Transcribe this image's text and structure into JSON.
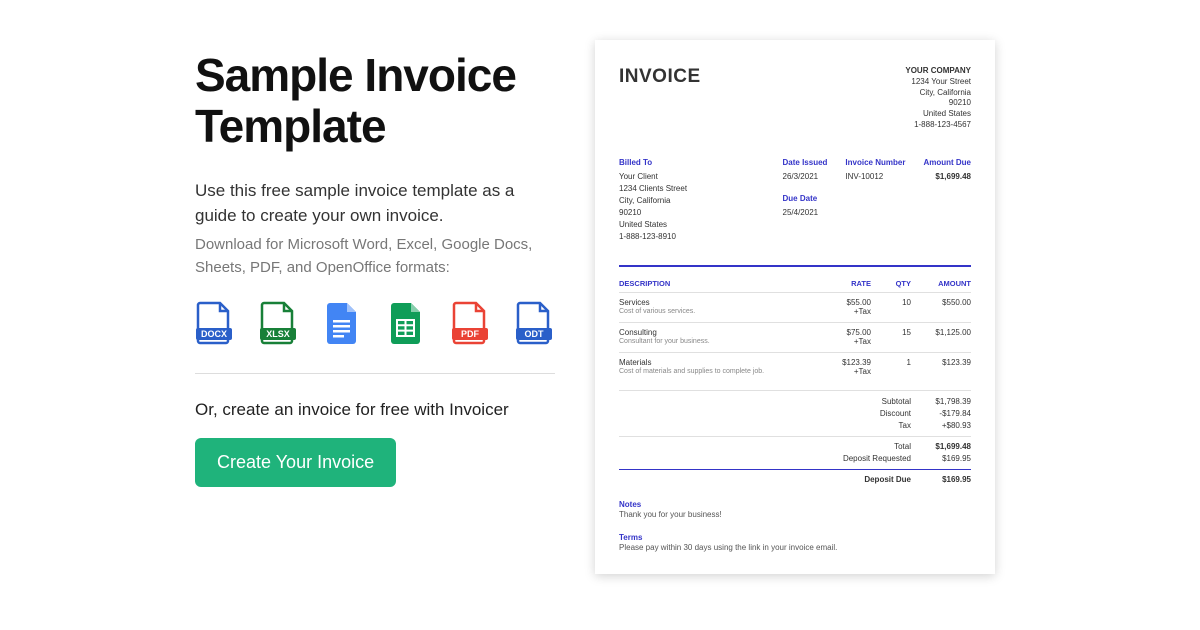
{
  "left": {
    "title": "Sample Invoice Template",
    "subtitle": "Use this free sample invoice template as a guide to create your own invoice.",
    "download_note": "Download for Microsoft Word, Excel, Google Docs, Sheets, PDF, and OpenOffice formats:",
    "or_line": "Or, create an invoice for free with Invoicer",
    "cta": "Create Your Invoice",
    "formats": [
      "DOCX",
      "XLSX",
      "GDOC",
      "GSHEET",
      "PDF",
      "ODT"
    ]
  },
  "invoice": {
    "title": "INVOICE",
    "company": {
      "name": "YOUR COMPANY",
      "street": "1234 Your Street",
      "city": "City, California",
      "zip": "90210",
      "country": "United States",
      "phone": "1-888-123-4567"
    },
    "billed": {
      "label": "Billed To",
      "name": "Your Client",
      "street": "1234 Clients Street",
      "city": "City, California",
      "zip": "90210",
      "country": "United States",
      "phone": "1-888-123-8910"
    },
    "date_issued": {
      "label": "Date Issued",
      "value": "26/3/2021"
    },
    "due_date": {
      "label": "Due Date",
      "value": "25/4/2021"
    },
    "invoice_number": {
      "label": "Invoice Number",
      "value": "INV-10012"
    },
    "amount_due": {
      "label": "Amount Due",
      "value": "$1,699.48"
    },
    "columns": {
      "desc": "DESCRIPTION",
      "rate": "RATE",
      "qty": "QTY",
      "amount": "AMOUNT"
    },
    "items": [
      {
        "name": "Services",
        "desc": "Cost of various services.",
        "rate": "$55.00",
        "tax": "+Tax",
        "qty": "10",
        "amount": "$550.00"
      },
      {
        "name": "Consulting",
        "desc": "Consultant for your business.",
        "rate": "$75.00",
        "tax": "+Tax",
        "qty": "15",
        "amount": "$1,125.00"
      },
      {
        "name": "Materials",
        "desc": "Cost of materials and supplies to complete job.",
        "rate": "$123.39",
        "tax": "+Tax",
        "qty": "1",
        "amount": "$123.39"
      }
    ],
    "summary": {
      "subtotal": {
        "label": "Subtotal",
        "value": "$1,798.39"
      },
      "discount": {
        "label": "Discount",
        "value": "-$179.84"
      },
      "tax": {
        "label": "Tax",
        "value": "+$80.93"
      },
      "total": {
        "label": "Total",
        "value": "$1,699.48"
      },
      "deposit_req": {
        "label": "Deposit Requested",
        "value": "$169.95"
      },
      "deposit_due": {
        "label": "Deposit Due",
        "value": "$169.95"
      }
    },
    "notes": {
      "label": "Notes",
      "text": "Thank you for your business!"
    },
    "terms": {
      "label": "Terms",
      "text": "Please pay within 30 days using the link in your invoice email."
    }
  }
}
